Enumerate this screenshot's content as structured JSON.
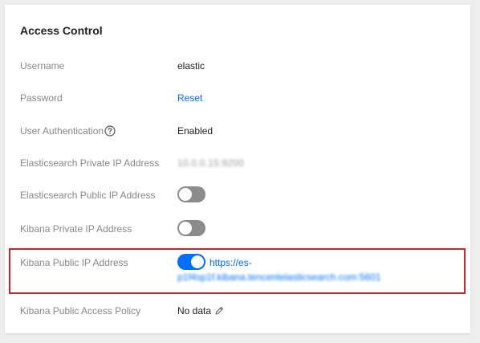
{
  "card": {
    "title": "Access Control",
    "rows": [
      {
        "label": "Username",
        "value": "elastic"
      },
      {
        "label": "Password",
        "value": "Reset"
      },
      {
        "label": "User Authentication",
        "value": "Enabled"
      },
      {
        "label": "Elasticsearch Private IP Address",
        "value": "10.0.0.15:9200"
      },
      {
        "label": "Elasticsearch Public IP Address",
        "toggle": "off"
      },
      {
        "label": "Kibana Private IP Address",
        "toggle": "off"
      },
      {
        "label": "Kibana Public IP Address",
        "toggle": "on",
        "url_line1": "https://es-",
        "url_line2": "p1f4sp1f.kibana.tencentelasticsearch.com:5601"
      },
      {
        "label": "Kibana Public Access Policy",
        "value": "No data"
      }
    ]
  },
  "colors": {
    "accent": "#006eff",
    "toggle_off": "#8c8c8c",
    "highlight": "#c8262e",
    "label": "#888888"
  },
  "icons": {
    "help": "question-circle-icon",
    "edit": "pencil-icon"
  }
}
